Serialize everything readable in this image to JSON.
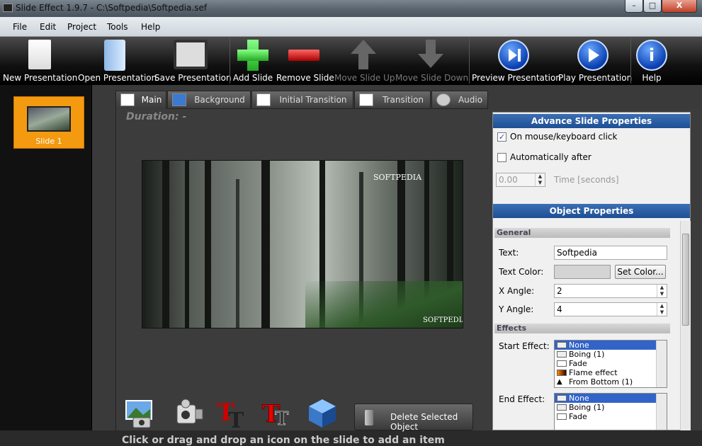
{
  "window": {
    "title": "Slide Effect 1.9.7 - C:\\Softpedia\\Softpedia.sef",
    "minimize": "–",
    "maximize": "□",
    "close": "X"
  },
  "menu": [
    "File",
    "Edit",
    "Project",
    "Tools",
    "Help"
  ],
  "toolbar": {
    "new": "New Presentation",
    "open": "Open Presentation",
    "save": "Save Presentation",
    "add": "Add Slide",
    "remove": "Remove Slide",
    "up": "Move Slide Up",
    "down": "Move Slide Down",
    "preview": "Preview Presentation",
    "play": "Play Presentation",
    "help": "Help",
    "help_glyph": "i"
  },
  "slides": [
    {
      "label": "Slide 1"
    }
  ],
  "tabs": [
    "Main",
    "Background",
    "Initial Transition",
    "Transition",
    "Audio"
  ],
  "main": {
    "duration": "Duration: -",
    "watermark_top": "SOFTPEDIA",
    "watermark_bottom": "SOFTPEDIA",
    "hint": "Click or drag and drop an icon on the slide to add an item",
    "delete_label": "Delete Selected Object"
  },
  "advance": {
    "header": "Advance Slide Properties",
    "on_mouse": "On mouse/keyboard click",
    "on_mouse_checked": true,
    "auto_after": "Automatically after",
    "auto_checked": false,
    "time_value": "0.00",
    "time_label": "Time [seconds]"
  },
  "object": {
    "header": "Object Properties",
    "general_header": "General",
    "text_label": "Text:",
    "text_value": "Softpedia",
    "color_label": "Text Color:",
    "set_color": "Set Color...",
    "x_label": "X Angle:",
    "x_value": "2",
    "y_label": "Y Angle:",
    "y_value": "4",
    "effects_header": "Effects",
    "start_label": "Start Effect:",
    "start_effects": [
      "None",
      "Boing (1)",
      "Fade",
      "Flame effect",
      "From Bottom (1)"
    ],
    "end_label": "End Effect:",
    "end_effects": [
      "None",
      "Boing (1)",
      "Fade"
    ]
  },
  "colors": {
    "accent_blue": "#1e4f94",
    "slide_orange": "#f39a10",
    "selection": "#3264c8"
  }
}
